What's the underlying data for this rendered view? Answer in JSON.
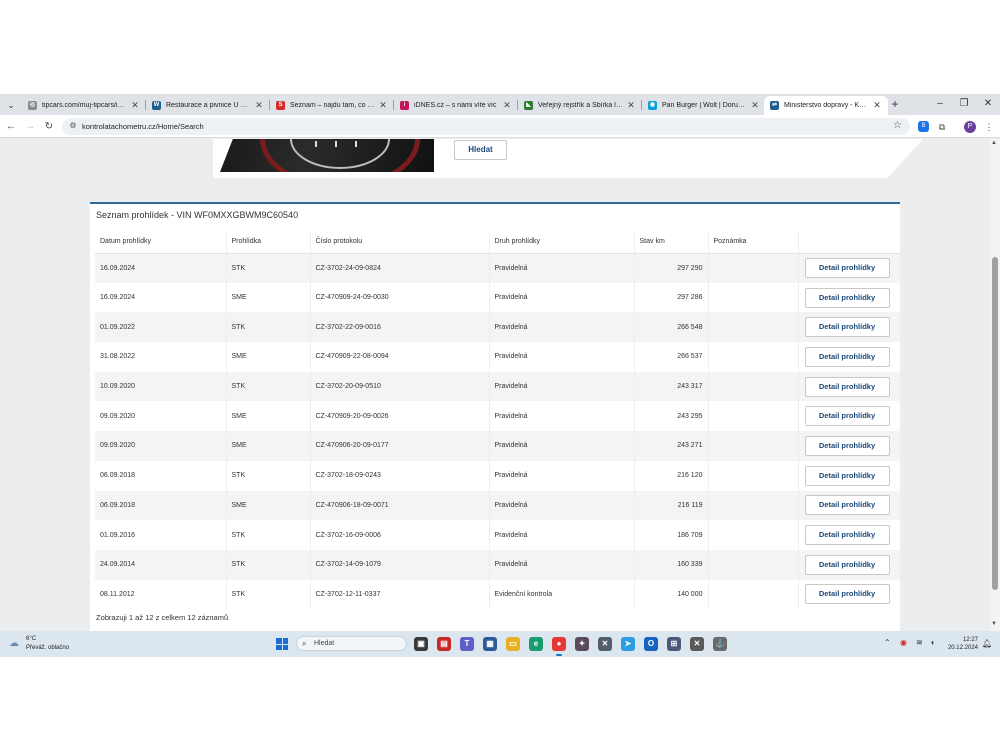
{
  "browser": {
    "tabs": [
      {
        "title": "tipcars.com/muj-tipcars/inzer",
        "favicon_color": "#8a8a8a",
        "favicon_glyph": "◎",
        "active": false
      },
      {
        "title": "Restaurace a pivnice U Hudečk",
        "favicon_color": "#1f5d8c",
        "favicon_glyph": "W",
        "active": false
      },
      {
        "title": "Seznam – najdu tam, co nezná",
        "favicon_color": "#d62b2b",
        "favicon_glyph": "S",
        "active": false
      },
      {
        "title": "iDNES.cz – s námi víte víc",
        "favicon_color": "#c2185b",
        "favicon_glyph": "i",
        "active": false
      },
      {
        "title": "Veřejný rejstřík a Sbírka listin",
        "favicon_color": "#2e7d32",
        "favicon_glyph": "◣",
        "active": false
      },
      {
        "title": "Pan Burger | Wolt | Doručení |",
        "favicon_color": "#0aa0d9",
        "favicon_glyph": "◉",
        "active": false
      },
      {
        "title": "Ministerstvo dopravy - Kontrol",
        "favicon_color": "#1f5d8c",
        "favicon_glyph": "⇌",
        "active": true
      }
    ],
    "url": "kontrolatachometru.cz/Home/Search",
    "icons": {
      "tab_search": "chevron-down-icon",
      "new_tab": "plus-icon",
      "back": "arrow-left-icon",
      "forward": "arrow-right-icon",
      "reload": "reload-icon",
      "bookmark": "star-icon",
      "extensions": "puzzle-icon",
      "menu": "kebab-menu-icon"
    },
    "extension_label": "B",
    "profile_initial": "P"
  },
  "page": {
    "search_button_label": "Hledat",
    "panel_title": "Seznam prohlídek - VIN WF0MXXGBWM9C60540",
    "columns": [
      "Datum prohlídky",
      "Prohlídka",
      "Číslo protokolu",
      "Druh prohlídky",
      "Stav km",
      "Poznámka",
      ""
    ],
    "rows": [
      {
        "date": "16.09.2024",
        "type": "STK",
        "protocol": "CZ-3702-24-09-0824",
        "kind": "Pravidelná",
        "km": "297 290",
        "note": "",
        "action": "Detail prohlídky"
      },
      {
        "date": "16.09.2024",
        "type": "SME",
        "protocol": "CZ-470909-24-09-0030",
        "kind": "Pravidelná",
        "km": "297 286",
        "note": "",
        "action": "Detail prohlídky"
      },
      {
        "date": "01.09.2022",
        "type": "STK",
        "protocol": "CZ-3702-22-09-0016",
        "kind": "Pravidelná",
        "km": "266 548",
        "note": "",
        "action": "Detail prohlídky"
      },
      {
        "date": "31.08.2022",
        "type": "SME",
        "protocol": "CZ-470909-22-08-0094",
        "kind": "Pravidelná",
        "km": "266 537",
        "note": "",
        "action": "Detail prohlídky"
      },
      {
        "date": "10.09.2020",
        "type": "STK",
        "protocol": "CZ-3702-20-09-0510",
        "kind": "Pravidelná",
        "km": "243 317",
        "note": "",
        "action": "Detail prohlídky"
      },
      {
        "date": "09.09.2020",
        "type": "SME",
        "protocol": "CZ-470909-20-09-0026",
        "kind": "Pravidelná",
        "km": "243 295",
        "note": "",
        "action": "Detail prohlídky"
      },
      {
        "date": "09.09.2020",
        "type": "SME",
        "protocol": "CZ-470906-20-09-0177",
        "kind": "Pravidelná",
        "km": "243 271",
        "note": "",
        "action": "Detail prohlídky"
      },
      {
        "date": "06.09.2018",
        "type": "STK",
        "protocol": "CZ-3702-18-09-0243",
        "kind": "Pravidelná",
        "km": "216 120",
        "note": "",
        "action": "Detail prohlídky"
      },
      {
        "date": "06.09.2018",
        "type": "SME",
        "protocol": "CZ-470906-18-09-0071",
        "kind": "Pravidelná",
        "km": "216 119",
        "note": "",
        "action": "Detail prohlídky"
      },
      {
        "date": "01.09.2016",
        "type": "STK",
        "protocol": "CZ-3702-16-09-0006",
        "kind": "Pravidelná",
        "km": "186 709",
        "note": "",
        "action": "Detail prohlídky"
      },
      {
        "date": "24.09.2014",
        "type": "STK",
        "protocol": "CZ-3702-14-09-1079",
        "kind": "Pravidelná",
        "km": "160 339",
        "note": "",
        "action": "Detail prohlídky"
      },
      {
        "date": "08.11.2012",
        "type": "STK",
        "protocol": "CZ-3702-12-11-0337",
        "kind": "Evidenční kontrola",
        "km": "140 000",
        "note": "",
        "action": "Detail prohlídky"
      }
    ],
    "footer": "Zobrazuji 1 až 12 z celkem 12 záznamů"
  },
  "taskbar": {
    "weather_temp": "6°C",
    "weather_desc": "Převáž. oblačno",
    "search_placeholder": "Hledat",
    "apps": [
      {
        "name": "task-view-icon",
        "color": "#3a3a3a",
        "glyph": "▣"
      },
      {
        "name": "pdf-app-icon",
        "color": "#c62828",
        "glyph": "▤"
      },
      {
        "name": "teams-icon",
        "color": "#5b5fc7",
        "glyph": "T"
      },
      {
        "name": "store-icon",
        "color": "#2d5b9a",
        "glyph": "▦"
      },
      {
        "name": "file-explorer-icon",
        "color": "#e8b020",
        "glyph": "▭"
      },
      {
        "name": "edge-icon",
        "color": "#1a9b6e",
        "glyph": "e"
      },
      {
        "name": "chrome-icon",
        "color": "#e53935",
        "glyph": "●"
      },
      {
        "name": "game-app-icon",
        "color": "#5a4a5a",
        "glyph": "✦"
      },
      {
        "name": "app-icon-1",
        "color": "#555e6e",
        "glyph": "✕"
      },
      {
        "name": "telegram-icon",
        "color": "#2a9ee0",
        "glyph": "➤"
      },
      {
        "name": "outlook-icon",
        "color": "#1565c0",
        "glyph": "O"
      },
      {
        "name": "app-icon-2",
        "color": "#4a5a78",
        "glyph": "⊞"
      },
      {
        "name": "app-icon-3",
        "color": "#5a5a5a",
        "glyph": "✕"
      },
      {
        "name": "app-icon-4",
        "color": "#6a6a6a",
        "glyph": "⚓"
      }
    ],
    "time": "12:27",
    "date": "20.12.2024"
  }
}
